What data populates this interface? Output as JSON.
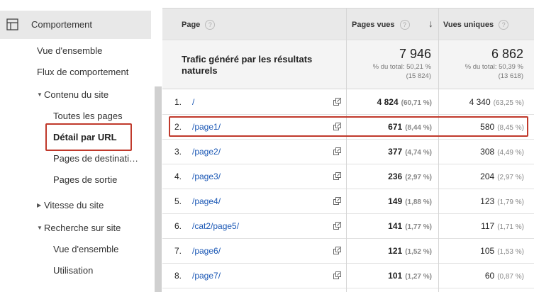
{
  "sidebar": {
    "header_label": "Comportement",
    "items": [
      {
        "label": "Vue d'ensemble"
      },
      {
        "label": "Flux de comportement"
      },
      {
        "label": "Contenu du site"
      },
      {
        "label": "Toutes les pages"
      },
      {
        "label": "Détail par URL"
      },
      {
        "label": "Pages de destinati…"
      },
      {
        "label": "Pages de sortie"
      },
      {
        "label": "Vitesse du site"
      },
      {
        "label": "Recherche sur site"
      },
      {
        "label": "Vue d'ensemble"
      },
      {
        "label": "Utilisation"
      }
    ]
  },
  "table": {
    "headers": {
      "page": "Page",
      "views": "Pages vues",
      "unique": "Vues uniques",
      "help": "?",
      "sort": "↓"
    },
    "summary": {
      "title": "Trafic généré par les résultats naturels",
      "views_total": "7 946",
      "views_pct_line1": "% du total: 50,21 %",
      "views_pct_line2": "(15 824)",
      "unique_total": "6 862",
      "unique_pct_line1": "% du total: 50,39 %",
      "unique_pct_line2": "(13 618)"
    },
    "rows": [
      {
        "num": "1.",
        "url": "/",
        "views": "4 824",
        "views_pct": "(60,71 %)",
        "unique": "4 340",
        "unique_pct": "(63,25 %)"
      },
      {
        "num": "2.",
        "url": "/page1/",
        "views": "671",
        "views_pct": "(8,44 %)",
        "unique": "580",
        "unique_pct": "(8,45 %)"
      },
      {
        "num": "3.",
        "url": "/page2/",
        "views": "377",
        "views_pct": "(4,74 %)",
        "unique": "308",
        "unique_pct": "(4,49 %)"
      },
      {
        "num": "4.",
        "url": "/page3/",
        "views": "236",
        "views_pct": "(2,97 %)",
        "unique": "204",
        "unique_pct": "(2,97 %)"
      },
      {
        "num": "5.",
        "url": "/page4/",
        "views": "149",
        "views_pct": "(1,88 %)",
        "unique": "123",
        "unique_pct": "(1,79 %)"
      },
      {
        "num": "6.",
        "url": "/cat2/page5/",
        "views": "141",
        "views_pct": "(1,77 %)",
        "unique": "117",
        "unique_pct": "(1,71 %)"
      },
      {
        "num": "7.",
        "url": "/page6/",
        "views": "121",
        "views_pct": "(1,52 %)",
        "unique": "105",
        "unique_pct": "(1,53 %)"
      },
      {
        "num": "8.",
        "url": "/page7/",
        "views": "101",
        "views_pct": "(1,27 %)",
        "unique": "60",
        "unique_pct": "(0,87 %)"
      }
    ]
  },
  "colors": {
    "highlight": "#c0392b",
    "link": "#1a57b5",
    "header_bg": "#e9e9e9"
  },
  "icons": {
    "section": "table-layout-icon",
    "external": "external-link-icon"
  }
}
